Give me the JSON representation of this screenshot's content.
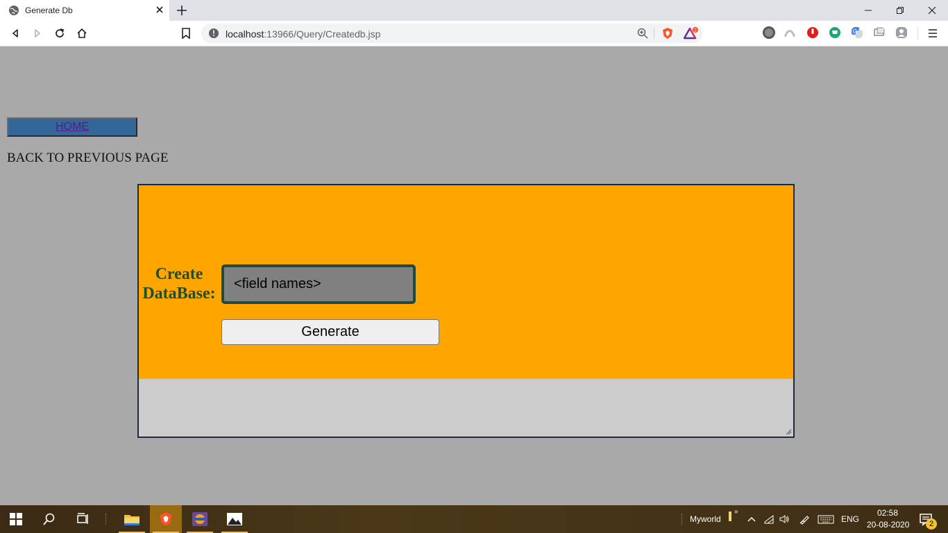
{
  "browser": {
    "tab_title": "Generate Db",
    "url_prefix": "localhost",
    "url_rest": ":13966/Query/Createdb.jsp",
    "rewards_badge": "2"
  },
  "page": {
    "home_link": "HOME",
    "back_text": "BACK TO PREVIOUS PAGE",
    "create_label": "Create DataBase:",
    "field_placeholder": "<field names>",
    "generate_button": "Generate",
    "colors": {
      "background": "#a9a9a9",
      "panel": "#ffa500",
      "label": "#1e4f2a"
    }
  },
  "taskbar": {
    "tray_label": "Myworld",
    "language": "ENG",
    "time": "02:58",
    "date": "20-08-2020",
    "notification_count": "2"
  }
}
